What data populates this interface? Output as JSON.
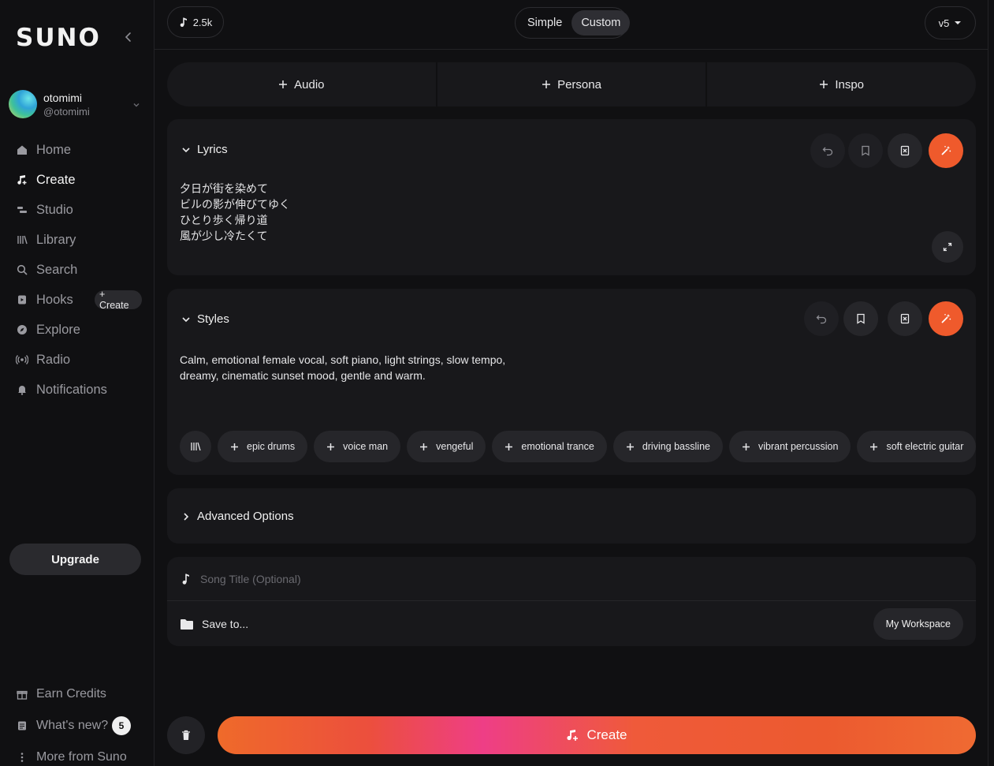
{
  "sidebar": {
    "logo": "SUNO",
    "profile": {
      "name": "otomimi",
      "handle": "@otomimi"
    },
    "nav": [
      {
        "label": "Home",
        "icon": "home-icon"
      },
      {
        "label": "Create",
        "icon": "music-note-icon",
        "active": true
      },
      {
        "label": "Studio",
        "icon": "studio-icon"
      },
      {
        "label": "Library",
        "icon": "library-icon"
      },
      {
        "label": "Search",
        "icon": "search-icon"
      },
      {
        "label": "Hooks",
        "icon": "hooks-icon",
        "action": "+ Create"
      },
      {
        "label": "Explore",
        "icon": "compass-icon"
      },
      {
        "label": "Radio",
        "icon": "radio-icon"
      },
      {
        "label": "Notifications",
        "icon": "bell-icon"
      }
    ],
    "upgrade": "Upgrade",
    "bottom": [
      {
        "label": "Earn Credits",
        "icon": "gift-icon"
      },
      {
        "label": "What's new?",
        "icon": "news-icon",
        "badge": "5"
      },
      {
        "label": "More from Suno",
        "icon": "more-vertical-icon"
      }
    ]
  },
  "topbar": {
    "credits": "2.5k",
    "modes": [
      "Simple",
      "Custom"
    ],
    "active_mode": "Custom",
    "version": "v5"
  },
  "add_buttons": [
    "Audio",
    "Persona",
    "Inspo"
  ],
  "lyrics": {
    "heading": "Lyrics",
    "text": "夕日が街を染めて\nビルの影が伸びてゆく\nひとり歩く帰り道\n風が少し冷たくて"
  },
  "styles": {
    "heading": "Styles",
    "text": "Calm, emotional female vocal, soft piano, light strings, slow tempo, dreamy, cinematic sunset mood, gentle and warm.",
    "tags": [
      "epic drums",
      "voice man",
      "vengeful",
      "emotional trance",
      "driving bassline",
      "vibrant percussion",
      "soft electric guitar"
    ]
  },
  "advanced": {
    "label": "Advanced Options"
  },
  "song": {
    "title_placeholder": "Song Title (Optional)",
    "save_to": "Save to...",
    "workspace": "My Workspace"
  },
  "create_button": "Create",
  "colors": {
    "accent": "#ef5a2c",
    "background": "#101012",
    "panel": "#18181b"
  }
}
